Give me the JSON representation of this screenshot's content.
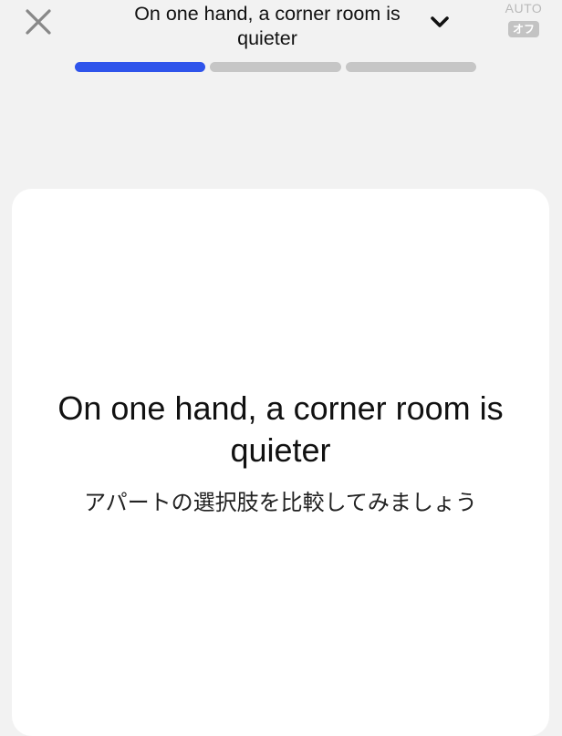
{
  "header": {
    "title": "On one hand, a corner room is quieter",
    "auto": {
      "label": "AUTO",
      "state": "オフ"
    }
  },
  "progress": {
    "segments": 3,
    "current": 1,
    "active_color": "#2f54eb",
    "inactive_color": "#c6c6c6"
  },
  "card": {
    "sentence": "On one hand, a corner room is quieter",
    "translation": "アパートの選択肢を比較してみましょう"
  },
  "icons": {
    "close": "close-icon",
    "dropdown": "chevron-down-icon"
  }
}
